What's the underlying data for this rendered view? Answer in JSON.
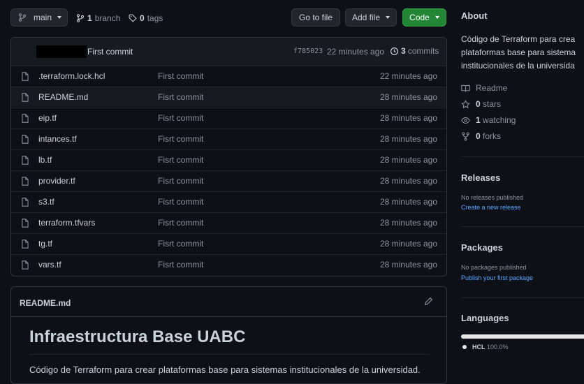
{
  "toolbar": {
    "branch": "main",
    "branch_count": "1",
    "branch_label": "branch",
    "tag_count": "0",
    "tag_label": "tags",
    "go_to_file": "Go to file",
    "add_file": "Add file",
    "code": "Code"
  },
  "commit_header": {
    "message": "First commit",
    "sha": "f785023",
    "age": "22 minutes ago",
    "commit_count": "3",
    "commit_label": "commits"
  },
  "files": [
    {
      "name": ".terraform.lock.hcl",
      "message": "First commit",
      "age": "22 minutes ago"
    },
    {
      "name": "README.md",
      "message": "Fisrt commit",
      "age": "28 minutes ago"
    },
    {
      "name": "eip.tf",
      "message": "Fisrt commit",
      "age": "28 minutes ago"
    },
    {
      "name": "intances.tf",
      "message": "Fisrt commit",
      "age": "28 minutes ago"
    },
    {
      "name": "lb.tf",
      "message": "Fisrt commit",
      "age": "28 minutes ago"
    },
    {
      "name": "provider.tf",
      "message": "Fisrt commit",
      "age": "28 minutes ago"
    },
    {
      "name": "s3.tf",
      "message": "Fisrt commit",
      "age": "28 minutes ago"
    },
    {
      "name": "terraform.tfvars",
      "message": "Fisrt commit",
      "age": "28 minutes ago"
    },
    {
      "name": "tg.tf",
      "message": "Fisrt commit",
      "age": "28 minutes ago"
    },
    {
      "name": "vars.tf",
      "message": "Fisrt commit",
      "age": "28 minutes ago"
    }
  ],
  "readme": {
    "filename": "README.md",
    "heading": "Infraestructura Base UABC",
    "body": "Código de Terraform para crear plataformas base para sistemas institucionales de la universidad."
  },
  "sidebar": {
    "about_title": "About",
    "description_lines": [
      "Código de Terraform para crea",
      "plataformas base para sistema",
      "institucionales de la universida"
    ],
    "readme_label": "Readme",
    "stars_count": "0",
    "stars_label": "stars",
    "watching_count": "1",
    "watching_label": "watching",
    "forks_count": "0",
    "forks_label": "forks",
    "releases_title": "Releases",
    "releases_none": "No releases published",
    "releases_link": "Create a new release",
    "packages_title": "Packages",
    "packages_none": "No packages published",
    "packages_link": "Publish your first package",
    "languages_title": "Languages",
    "language_name": "HCL",
    "language_percent": "100.0%"
  },
  "colors": {
    "accent_green": "#238636",
    "link_blue": "#58a6ff",
    "language_bar": "#e6e6e6"
  }
}
